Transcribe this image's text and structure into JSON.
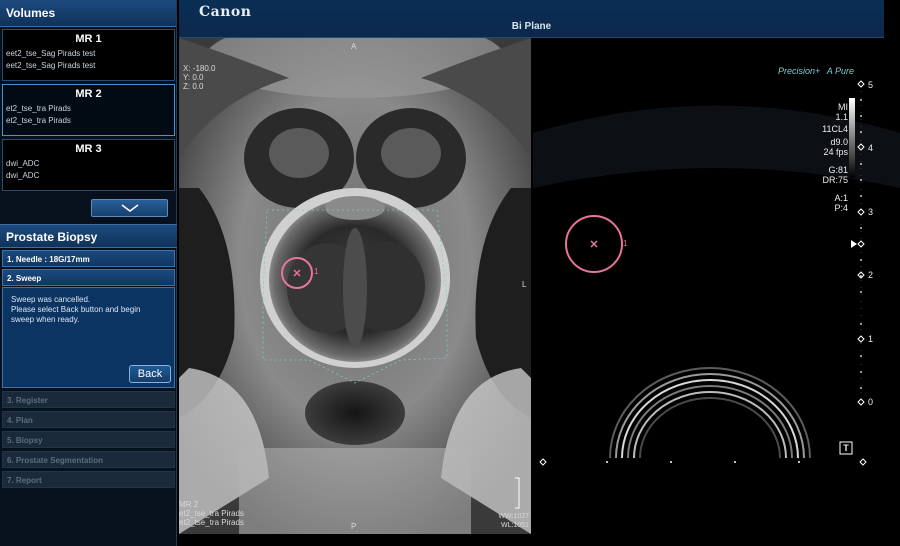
{
  "volumes": {
    "header": "Volumes",
    "items": [
      {
        "title": "MR 1",
        "lines": [
          "eet2_tse_Sag Pirads test",
          "eet2_tse_Sag Pirads test"
        ]
      },
      {
        "title": "MR 2",
        "lines": [
          "et2_tse_tra Pirads",
          "et2_tse_tra Pirads"
        ]
      },
      {
        "title": "MR 3",
        "lines": [
          "dwi_ADC",
          "dwi_ADC"
        ]
      }
    ]
  },
  "biopsy": {
    "header": "Prostate Biopsy",
    "steps": [
      {
        "label": "1. Needle : 18G/17mm",
        "state": "done"
      },
      {
        "label": "2. Sweep",
        "state": "active"
      },
      {
        "label": "3. Register",
        "state": "disabled"
      },
      {
        "label": "4. Plan",
        "state": "disabled"
      },
      {
        "label": "5. Biopsy",
        "state": "disabled"
      },
      {
        "label": "6. Prostate Segmentation",
        "state": "disabled"
      },
      {
        "label": "7. Report",
        "state": "disabled"
      }
    ],
    "sweep_message": [
      "Sweep was cancelled.",
      "Please select Back button and begin",
      "sweep when ready."
    ],
    "back_label": "Back"
  },
  "header": {
    "brand": "Canon",
    "view_title": "Bi Plane"
  },
  "mr": {
    "orient_top": "A",
    "orient_bottom": "P",
    "orient_right": "L",
    "coords": [
      "X: -180.0",
      "Y: 0.0",
      "Z: 0.0"
    ],
    "target_label": "1",
    "footer": [
      "MR 2",
      "et2_tse_tra Pirads",
      "et2_tse_tra Pirads"
    ],
    "window": [
      "WW:1027",
      "WL:1051"
    ]
  },
  "us": {
    "brand_precision": "Precision+",
    "brand_apure": "A Pure",
    "params": [
      "MI",
      "1.1",
      "11CL4",
      "d9.0",
      "24 fps",
      "",
      "G:81",
      "DR:75",
      "",
      "A:1",
      "P:4"
    ],
    "depth_ticks": [
      "5",
      "4",
      "3",
      "2",
      "1",
      "0"
    ],
    "target_label": "1",
    "t_marker": "T"
  },
  "colors": {
    "target": "#e8769a",
    "accent": "#1d4a7e",
    "roi": "#7fc9c9"
  }
}
